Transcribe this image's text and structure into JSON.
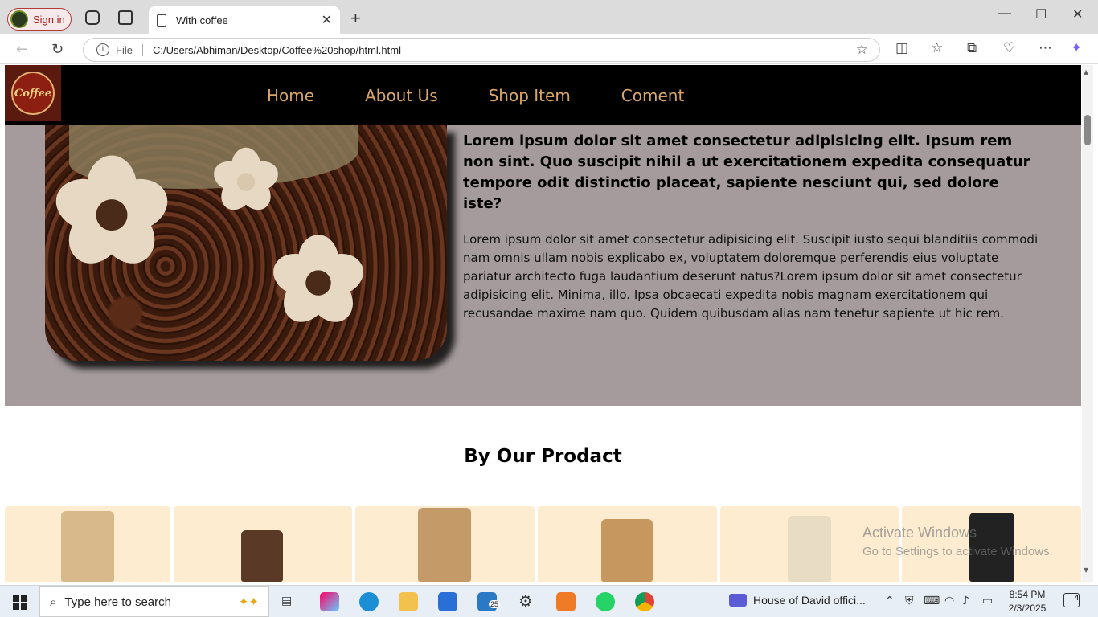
{
  "browser": {
    "signin_label": "Sign in",
    "tab_title": "With coffee",
    "tab_close": "✕",
    "new_tab": "+",
    "url_prefix": "File",
    "url": "C:/Users/Abhiman/Desktop/Coffee%20shop/html.html"
  },
  "site": {
    "logo_text": "Coffee",
    "nav": [
      "Home",
      "About Us",
      "Shop Item",
      "Coment"
    ],
    "hero_title": "Lorem ipsum dolor sit amet consectetur adipisicing elit. Ipsum rem non sint. Quo suscipit nihil a ut exercitationem expedita consequatur tempore odit distinctio placeat, sapiente nesciunt qui, sed dolore iste?",
    "hero_body": "Lorem ipsum dolor sit amet consectetur adipisicing elit. Suscipit iusto sequi blanditiis commodi nam omnis ullam nobis explicabo ex, voluptatem doloremque perferendis eius voluptate pariatur architecto fuga laudantium deserunt natus?Lorem ipsum dolor sit amet consectetur adipisicing elit. Minima, illo. Ipsa obcaecati expedita nobis magnam exercitationem qui recusandae maxime nam quo. Quidem quibusdam alias nam tenetur sapiente ut hic rem.",
    "section_title": "By Our Prodact"
  },
  "watermark": {
    "line1": "Activate Windows",
    "line2": "Go to Settings to activate Windows."
  },
  "taskbar": {
    "search_placeholder": "Type here to search",
    "mail_badge": "25",
    "media_title": "House of David offici...",
    "time": "8:54 PM",
    "date": "2/3/2025",
    "notif_count": "4"
  },
  "colors": {
    "nav_bg": "#000000",
    "nav_text": "#d9a66a",
    "hero_bg": "#a59b9d",
    "product_card_bg": "#fdecd0"
  }
}
